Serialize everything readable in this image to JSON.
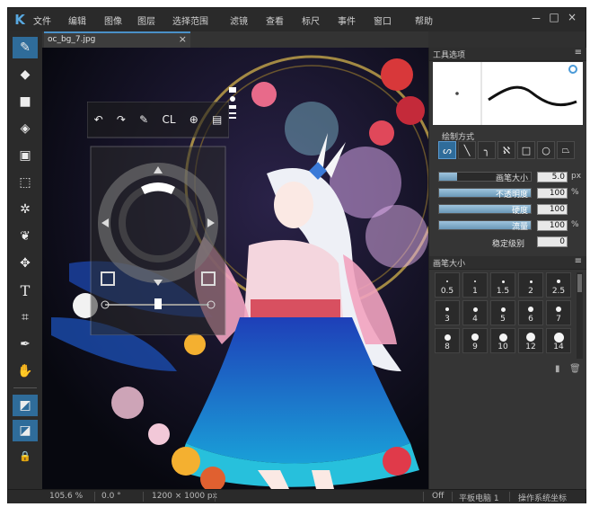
{
  "menubar": {
    "logo": "K",
    "items": [
      "文件",
      "编辑",
      "图像",
      "图层",
      "选择范围",
      "滤镜",
      "查看",
      "标尺",
      "事件",
      "窗口",
      "帮助"
    ],
    "window_buttons": [
      "－",
      "□",
      "×"
    ]
  },
  "document_tab": {
    "filename": "oc_bg_7.jpg",
    "close": "×"
  },
  "tools": [
    {
      "name": "brush-tool-icon",
      "glyph": "✎",
      "active": true
    },
    {
      "name": "eraser-tool-icon",
      "glyph": "◆",
      "active": false
    },
    {
      "name": "shape-tool-icon",
      "glyph": "■",
      "active": false
    },
    {
      "name": "fill-tool-icon",
      "glyph": "◈",
      "active": false
    },
    {
      "name": "gradient-tool-icon",
      "glyph": "▣",
      "active": false
    },
    {
      "name": "select-rect-tool-icon",
      "glyph": "⬚",
      "active": false
    },
    {
      "name": "magic-wand-tool-icon",
      "glyph": "✲",
      "active": false
    },
    {
      "name": "lasso-tool-icon",
      "glyph": "❦",
      "active": false
    },
    {
      "name": "move-tool-icon",
      "glyph": "✥",
      "active": false
    },
    {
      "name": "text-tool-icon",
      "glyph": "T",
      "active": false
    },
    {
      "name": "crop-tool-icon",
      "glyph": "⌗",
      "active": false
    },
    {
      "name": "eyedropper-tool-icon",
      "glyph": "✒",
      "active": false
    },
    {
      "name": "hand-tool-icon",
      "glyph": "✋",
      "active": false
    }
  ],
  "tools_bottom": [
    {
      "name": "color-swatch-icon",
      "glyph": "◩",
      "active": true
    },
    {
      "name": "layer-mode-icon",
      "glyph": "◪",
      "active": true
    },
    {
      "name": "lock-icon",
      "glyph": "🔒",
      "active": false
    }
  ],
  "hud": {
    "top_icons": [
      "undo-icon",
      "redo-icon",
      "pen-icon",
      "clear-icon",
      "symmetry-icon",
      "layer-icon"
    ],
    "cl_label": "CL"
  },
  "tool_options": {
    "title": "工具选项",
    "menu": "≡",
    "drawing_mode_label": "绘制方式",
    "shapes": [
      {
        "name": "freehand-shape-icon",
        "glyph": "ᔕ",
        "selected": true
      },
      {
        "name": "line-shape-icon",
        "glyph": "╲",
        "selected": false
      },
      {
        "name": "curve-shape-icon",
        "glyph": "╮",
        "selected": false
      },
      {
        "name": "polyline-shape-icon",
        "glyph": "ℵ",
        "selected": false
      },
      {
        "name": "rect-shape-icon",
        "glyph": "□",
        "selected": false
      },
      {
        "name": "ellipse-shape-icon",
        "glyph": "○",
        "selected": false
      },
      {
        "name": "polygon-shape-icon",
        "glyph": "⏢",
        "selected": false
      }
    ],
    "brush_size": {
      "label": "画笔大小",
      "value": "5.0",
      "unit": "px",
      "level": 0.2
    },
    "opacity": {
      "label": "不透明度",
      "value": "100",
      "unit": "%",
      "level": 1.0
    },
    "hardness": {
      "label": "硬度",
      "value": "100",
      "unit": "",
      "level": 1.0
    },
    "flow": {
      "label": "流量",
      "value": "100",
      "unit": "%",
      "level": 1.0
    },
    "stabilizer": {
      "label": "稳定级别",
      "value": "0"
    }
  },
  "brush_sizes": {
    "title": "画笔大小",
    "menu": "≡",
    "rows": [
      [
        "0.5",
        "1",
        "1.5",
        "2",
        "2.5"
      ],
      [
        "3",
        "4",
        "5",
        "6",
        "7"
      ],
      [
        "8",
        "9",
        "10",
        "12",
        "14"
      ]
    ]
  },
  "status": {
    "zoom": "105.6 %",
    "angle": "0.0 °",
    "size": "1200 × 1000 px",
    "off": "Off",
    "tablet": "平板电脑 1",
    "coords": "操作系统坐标"
  },
  "colors": {
    "accent": "#2f6c9a",
    "background": "#303030",
    "canvas_dark": "#0c0d1a"
  }
}
